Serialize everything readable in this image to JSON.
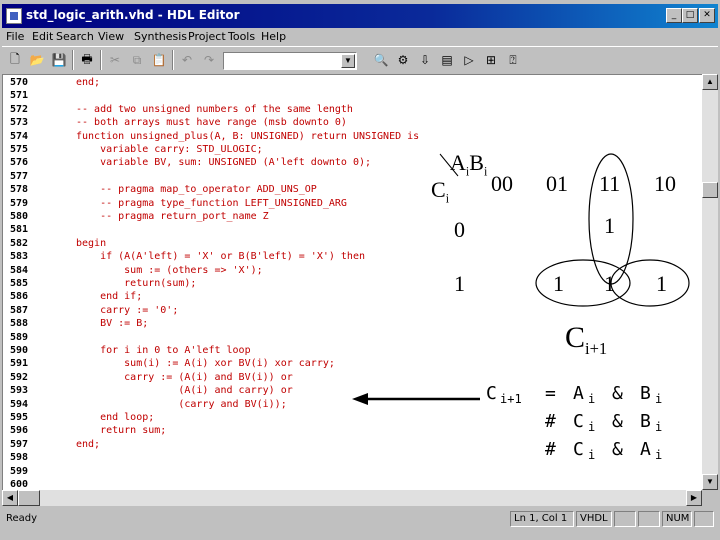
{
  "window": {
    "title": "std_logic_arith.vhd - HDL Editor",
    "buttons": {
      "minimize": "_",
      "maximize": "□",
      "close": "✕"
    }
  },
  "menu": [
    "File",
    "Edit",
    "Search",
    "View",
    "Synthesis",
    "Project",
    "Tools",
    "Help"
  ],
  "toolbar": {
    "icons": [
      "new-file-icon",
      "open-folder-icon",
      "save-icon",
      "print-icon",
      "cut-icon",
      "copy-icon",
      "paste-icon",
      "undo-icon",
      "redo-icon",
      "find-icon",
      "compile-icon",
      "download-icon",
      "library-icon",
      "simulate-icon",
      "hierarchy-icon",
      "help-cursor-icon"
    ],
    "combo_value": ""
  },
  "code_lines": [
    {
      "n": "570",
      "text": "end;"
    },
    {
      "n": "571",
      "text": ""
    },
    {
      "n": "572",
      "text": "-- add two unsigned numbers of the same length"
    },
    {
      "n": "573",
      "text": "-- both arrays must have range (msb downto 0)"
    },
    {
      "n": "574",
      "text": "function unsigned_plus(A, B: UNSIGNED) return UNSIGNED is"
    },
    {
      "n": "575",
      "text": "    variable carry: STD_ULOGIC;"
    },
    {
      "n": "576",
      "text": "    variable BV, sum: UNSIGNED (A'left downto 0);"
    },
    {
      "n": "577",
      "text": ""
    },
    {
      "n": "578",
      "text": "    -- pragma map_to_operator ADD_UNS_OP"
    },
    {
      "n": "579",
      "text": "    -- pragma type_function LEFT_UNSIGNED_ARG"
    },
    {
      "n": "580",
      "text": "    -- pragma return_port_name Z"
    },
    {
      "n": "581",
      "text": ""
    },
    {
      "n": "582",
      "text": "begin"
    },
    {
      "n": "583",
      "text": "    if (A(A'left) = 'X' or B(B'left) = 'X') then"
    },
    {
      "n": "584",
      "text": "        sum := (others => 'X');"
    },
    {
      "n": "585",
      "text": "        return(sum);"
    },
    {
      "n": "586",
      "text": "    end if;"
    },
    {
      "n": "587",
      "text": "    carry := '0';"
    },
    {
      "n": "588",
      "text": "    BV := B;"
    },
    {
      "n": "589",
      "text": ""
    },
    {
      "n": "590",
      "text": "    for i in 0 to A'left loop"
    },
    {
      "n": "591",
      "text": "        sum(i) := A(i) xor BV(i) xor carry;"
    },
    {
      "n": "592",
      "text": "        carry := (A(i) and BV(i)) or"
    },
    {
      "n": "593",
      "text": "                 (A(i) and carry) or"
    },
    {
      "n": "594",
      "text": "                 (carry and BV(i));"
    },
    {
      "n": "595",
      "text": "    end loop;"
    },
    {
      "n": "596",
      "text": "    return sum;"
    },
    {
      "n": "597",
      "text": "end;"
    },
    {
      "n": "598",
      "text": ""
    },
    {
      "n": "599",
      "text": ""
    },
    {
      "n": "600",
      "text": ""
    }
  ],
  "kmap": {
    "header_a": "A",
    "header_a_sub": "i",
    "header_b": "B",
    "header_b_sub": "i",
    "row_var": "C",
    "row_var_sub": "i",
    "cols": [
      "00",
      "01",
      "11",
      "10"
    ],
    "rows": [
      "0",
      "1"
    ],
    "cells_row0": [
      "",
      "",
      "1",
      ""
    ],
    "cells_row1": [
      "",
      "1",
      "1",
      "1"
    ],
    "output": "C",
    "output_sub": "i+1"
  },
  "equations": [
    {
      "prefix": "C",
      "prefix_sub": "i+1",
      "op": "=",
      "t1": "A",
      "t1_sub": "i",
      "amp": "&",
      "t2": "B",
      "t2_sub": "i"
    },
    {
      "prefix": "",
      "prefix_sub": "",
      "op": "#",
      "t1": "C",
      "t1_sub": "i",
      "amp": "&",
      "t2": "B",
      "t2_sub": "i"
    },
    {
      "prefix": "",
      "prefix_sub": "",
      "op": "#",
      "t1": "C",
      "t1_sub": "i",
      "amp": "&",
      "t2": "A",
      "t2_sub": "i"
    }
  ],
  "status": {
    "ready": "Ready",
    "position": "Ln 1, Col 1",
    "language": "VHDL",
    "num": "NUM"
  }
}
